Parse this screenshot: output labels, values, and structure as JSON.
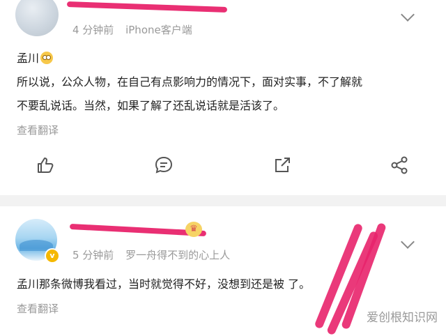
{
  "post1": {
    "username": "",
    "time": "4 分钟前",
    "source": "iPhone客户端",
    "lines": [
      "孟川",
      "所以说，公众人物，在自己有点影响力的情况下，面对实事，不了解就",
      "不要乱说话。当然，如果了解了还乱说话就是活该了。"
    ],
    "translate": "查看翻译",
    "actions": [
      "like-icon",
      "comment-icon",
      "repost-icon",
      "share-icon"
    ]
  },
  "post2": {
    "username": "",
    "time": "5 分钟前",
    "source": "罗一舟得不到的心上人",
    "text": "孟川那条微博我看过，当时就觉得不好，没想到还是被   了。",
    "translate": "查看翻译"
  },
  "watermark": "爱创根知识网",
  "colors": {
    "scribble": "#e8246b",
    "muted": "#999999",
    "divider": "#f2f2f2"
  }
}
